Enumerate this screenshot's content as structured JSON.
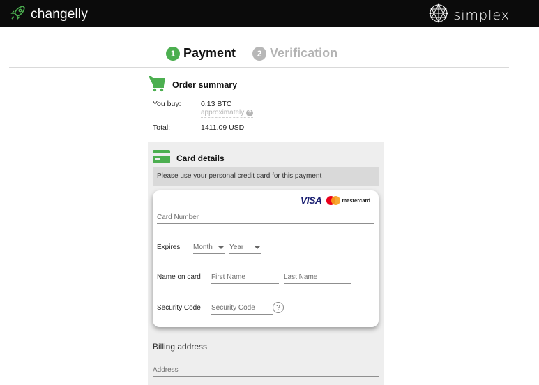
{
  "header": {
    "left_brand": "changelly",
    "right_brand": "simplex",
    "colors": {
      "bar": "#0b0b0b",
      "accent": "#4caf50"
    }
  },
  "steps": [
    {
      "number": "1",
      "label": "Payment",
      "state": "active"
    },
    {
      "number": "2",
      "label": "Verification",
      "state": "inactive"
    }
  ],
  "order_summary": {
    "title": "Order summary",
    "icon": "cart-icon",
    "you_buy_label": "You buy:",
    "you_buy_value": "0.13 BTC",
    "approx_note": "approximately",
    "approx_help": "?",
    "total_label": "Total:",
    "total_value": "1411.09 USD"
  },
  "card_details": {
    "title": "Card details",
    "icon": "credit-card-icon",
    "notice": "Please use your personal credit card for this payment",
    "brands": {
      "visa": "VISA",
      "mastercard": "mastercard"
    },
    "card_number_placeholder": "Card Number",
    "expires_label": "Expires",
    "month_value": "Month",
    "year_value": "Year",
    "name_label": "Name on card",
    "first_name_placeholder": "First Name",
    "last_name_placeholder": "Last Name",
    "security_label": "Security Code",
    "security_placeholder": "Security Code",
    "security_help": "?"
  },
  "billing": {
    "title": "Billing address",
    "address_placeholder": "Address"
  }
}
